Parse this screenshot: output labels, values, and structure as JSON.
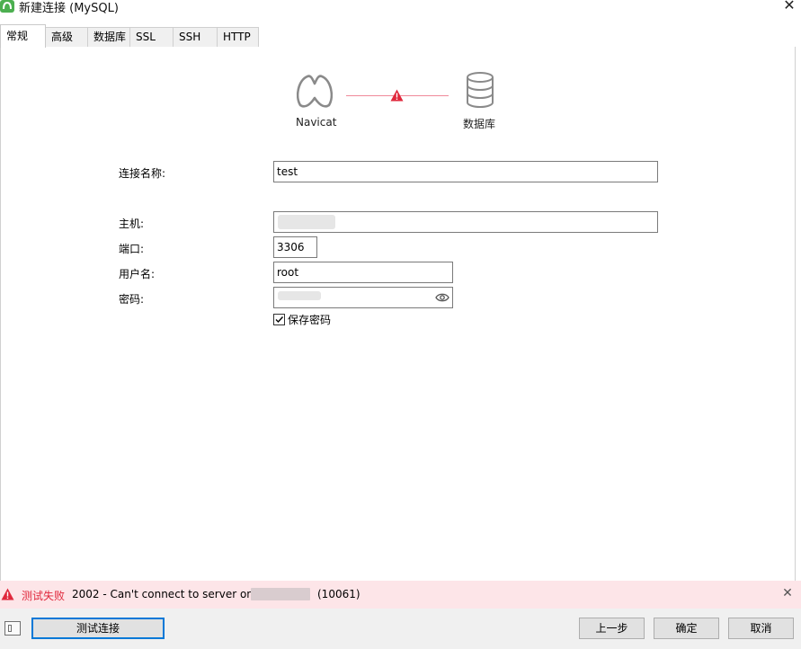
{
  "window": {
    "title": "新建连接 (MySQL)"
  },
  "tabs": [
    {
      "label": "常规",
      "active": true
    },
    {
      "label": "高级"
    },
    {
      "label": "数据库"
    },
    {
      "label": "SSL"
    },
    {
      "label": "SSH"
    },
    {
      "label": "HTTP"
    }
  ],
  "diagram": {
    "client_label": "Navicat",
    "server_label": "数据库"
  },
  "form": {
    "connection_name": {
      "label": "连接名称:",
      "value": "test"
    },
    "host": {
      "label": "主机:",
      "value": ""
    },
    "port": {
      "label": "端口:",
      "value": "3306"
    },
    "username": {
      "label": "用户名:",
      "value": "root"
    },
    "password": {
      "label": "密码:",
      "value": ""
    },
    "save_password": {
      "label": "保存密码",
      "checked": true
    }
  },
  "error": {
    "title": "测试失败",
    "message": "2002 - Can't connect to server on",
    "code": "(10061)"
  },
  "buttons": {
    "test_connection": "测试连接",
    "back": "上一步",
    "ok": "确定",
    "cancel": "取消"
  },
  "colors": {
    "error": "#e0283c",
    "error_bg": "#fde5e8",
    "accent": "#0078d7"
  }
}
